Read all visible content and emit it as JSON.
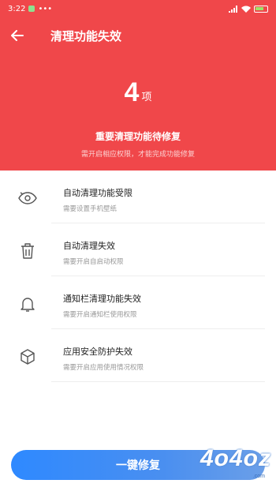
{
  "status_bar": {
    "time": "3:22",
    "dots": "•••"
  },
  "topbar": {
    "title": "清理功能失效"
  },
  "summary": {
    "count": "4",
    "unit": "项",
    "subtitle": "重要清理功能待修复",
    "note": "需开启相应权限，才能完成功能修复"
  },
  "items": [
    {
      "icon": "eye-refresh-icon",
      "title": "自动清理功能受限",
      "desc": "需要设置手机壁纸"
    },
    {
      "icon": "trash-icon",
      "title": "自动清理失效",
      "desc": "需要开启自启动权限"
    },
    {
      "icon": "bell-icon",
      "title": "通知栏清理功能失效",
      "desc": "需要开启通知栏使用权限"
    },
    {
      "icon": "cube-icon",
      "title": "应用安全防护失效",
      "desc": "需要开启应用使用情况权限"
    }
  ],
  "fix_button": {
    "label": "一键修复"
  },
  "watermark": {
    "text": "4o4oz",
    "sub": ".com"
  },
  "colors": {
    "header": "#f0474a",
    "button": "#2e89ff"
  }
}
